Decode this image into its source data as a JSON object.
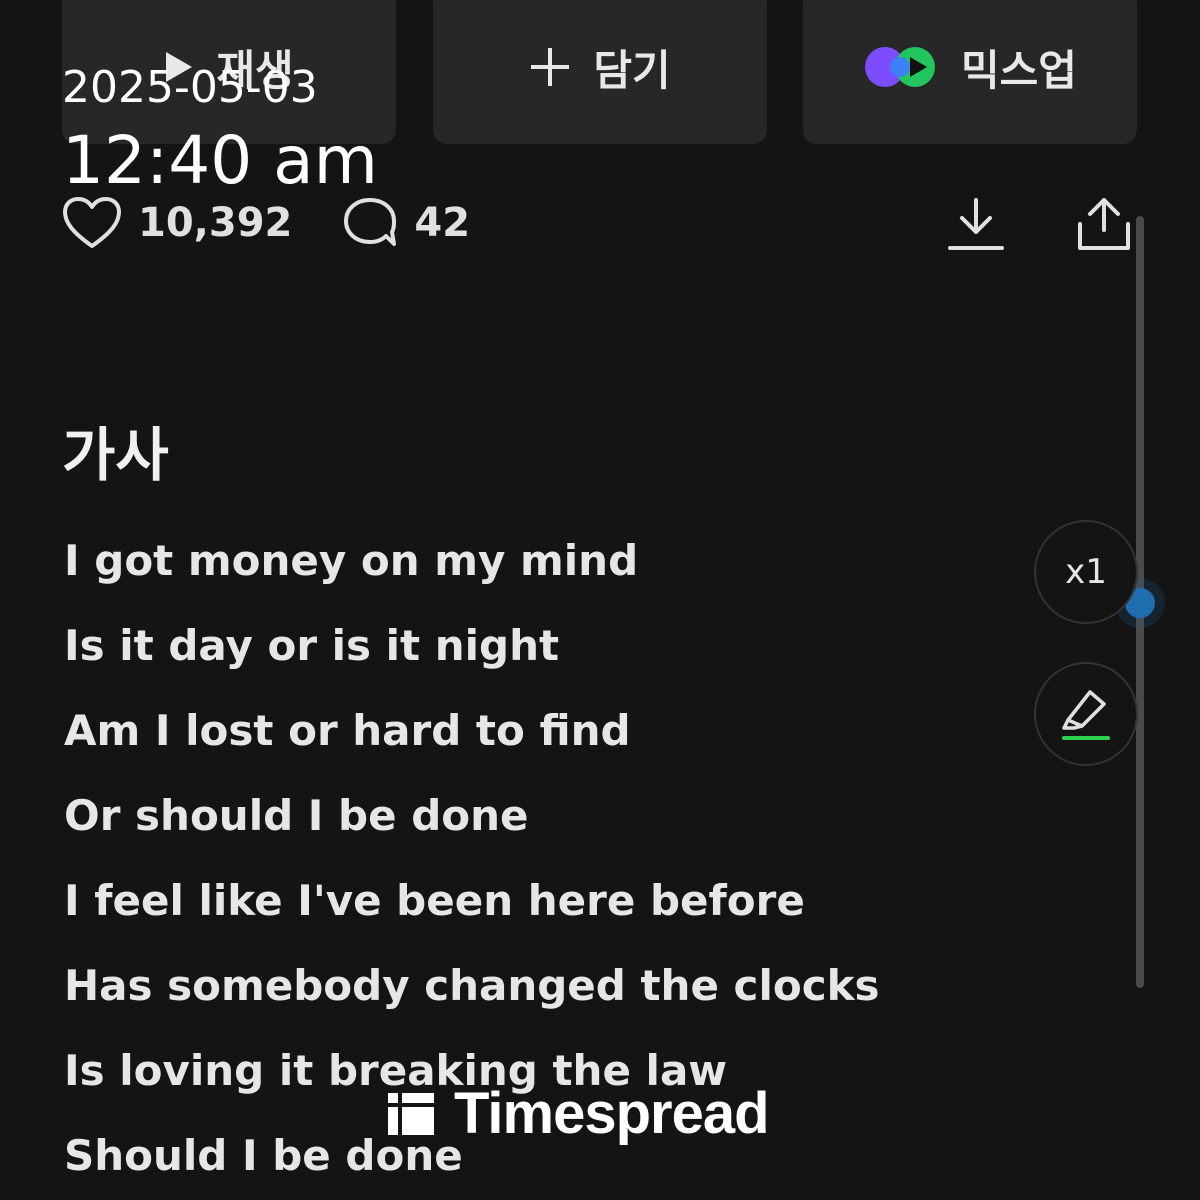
{
  "actions": {
    "play_label": "재생",
    "add_label": "담기",
    "mixup_label": "믹스업"
  },
  "overlay": {
    "date": "2025-05-03",
    "time": "12:40 am"
  },
  "stats": {
    "likes": "10,392",
    "comments": "42"
  },
  "lyrics": {
    "title": "가사",
    "lines": [
      "I got money on my mind",
      "Is it day or is it night",
      "Am I lost or hard to find",
      "Or should I be done",
      "I feel like I've been here before",
      "Has somebody changed the clocks",
      "Is loving it breaking the law",
      "Should I be done"
    ]
  },
  "controls": {
    "speed": "x1"
  },
  "watermark": "Timespread",
  "icons": [
    "play-icon",
    "plus-icon",
    "mixup-logo-icon",
    "heart-icon",
    "comment-icon",
    "download-icon",
    "share-icon",
    "highlighter-icon",
    "timespread-logo-icon"
  ],
  "colors": {
    "background": "#141414",
    "button": "#272727",
    "scroll_thumb": "#1f6fb0",
    "highlight_green": "#2bd14a"
  }
}
